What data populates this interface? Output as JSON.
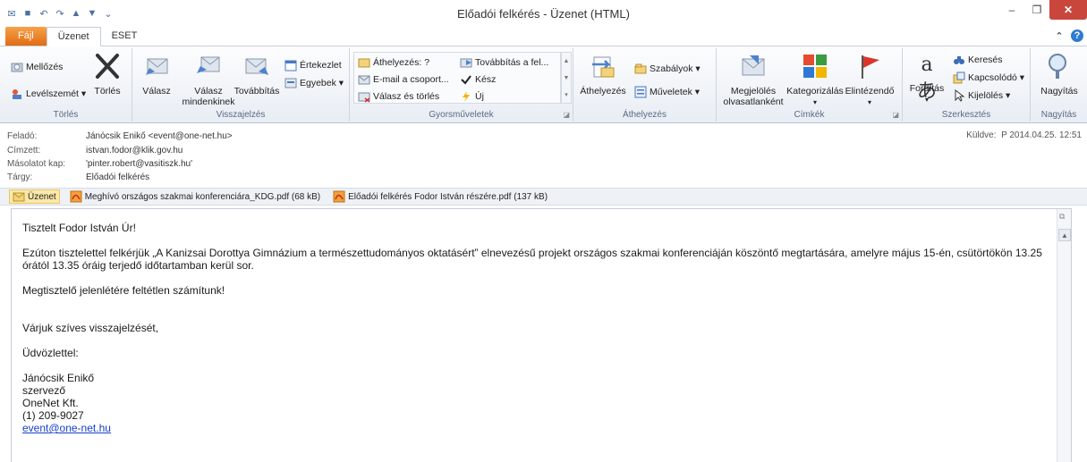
{
  "window": {
    "title": "Előadói felkérés - Üzenet (HTML)",
    "minimize": "–",
    "restore": "❐",
    "close": "✕"
  },
  "tabs": [
    {
      "label": "Fájl"
    },
    {
      "label": "Üzenet"
    },
    {
      "label": "ESET"
    }
  ],
  "ribbon": {
    "groups": {
      "torles": "Törlés",
      "valaszadas": "Visszajelzés",
      "gyors": "Gyorsműveletek",
      "athelyezes": "Áthelyezés",
      "cimkek": "Címkék",
      "szerkesztes": "Szerkesztés",
      "nagyitas": "Nagyítás"
    },
    "buttons": {
      "mellozes": "Mellőzés",
      "levelszemet": "Levélszemét ▾",
      "torles": "Törlés",
      "valasz": "Válasz",
      "valasz_mind_1": "Válasz",
      "valasz_mind_2": "mindenkinek",
      "tovabbitas": "Továbbítás",
      "ertekezlet": "Értekezlet",
      "egyebek": "Egyebek ▾",
      "athelyezes_q": "Áthelyezés: ?",
      "email_csoport": "E-mail a csoport...",
      "valasz_torles": "Válasz és törlés",
      "tovabbitas_fel": "Továbbítás a fel...",
      "kesz": "Kész",
      "uj": "Új",
      "athelyezes": "Áthelyezés",
      "szabalyok": "Szabályok ▾",
      "muveletek": "Műveletek ▾",
      "megjeloles_1": "Megjelölés",
      "megjeloles_2": "olvasatlanként",
      "kategorizalas": "Kategorizálás",
      "elintezendo": "Elintézendő",
      "forditas": "Fordítás",
      "kereses": "Keresés",
      "kapcsolodo": "Kapcsolódó ▾",
      "kijeloles": "Kijelölés ▾",
      "nagyitas": "Nagyítás"
    }
  },
  "header": {
    "from_label": "Feladó:",
    "from": "Jánócsik Enikő <event@one-net.hu>",
    "to_label": "Címzett:",
    "to": "istvan.fodor@klik.gov.hu",
    "cc_label": "Másolatot kap:",
    "cc": "'pinter.robert@vasitiszk.hu'",
    "subject_label": "Tárgy:",
    "subject": "Előadói felkérés",
    "sent_label": "Küldve:",
    "sent": "P 2014.04.25. 12:51"
  },
  "attachments": [
    {
      "label": "Üzenet"
    },
    {
      "label": "Meghívó országos szakmai konferenciára_KDG.pdf (68 kB)"
    },
    {
      "label": "Előadói felkérés Fodor István részére.pdf (137 kB)"
    }
  ],
  "message": {
    "greeting": "Tisztelt Fodor István Úr!",
    "p1": "Ezúton tisztelettel felkérjük „A Kanizsai Dorottya Gimnázium a természettudományos oktatásért” elnevezésű projekt országos szakmai konferenciáján köszöntő megtartására, amelyre május 15-én, csütörtökön 13.25 órától 13.35 óráig terjedő időtartamban kerül sor.",
    "p2": "Megtisztelő jelenlétére feltétlen számítunk!",
    "p3": "Várjuk szíves visszajelzését,",
    "closing": "Üdvözlettel:",
    "sig_name": "Jánócsik Enikő",
    "sig_role": "szervező",
    "sig_company": "OneNet Kft.",
    "sig_phone": "(1) 209-9027",
    "sig_email": "event@one-net.hu"
  }
}
